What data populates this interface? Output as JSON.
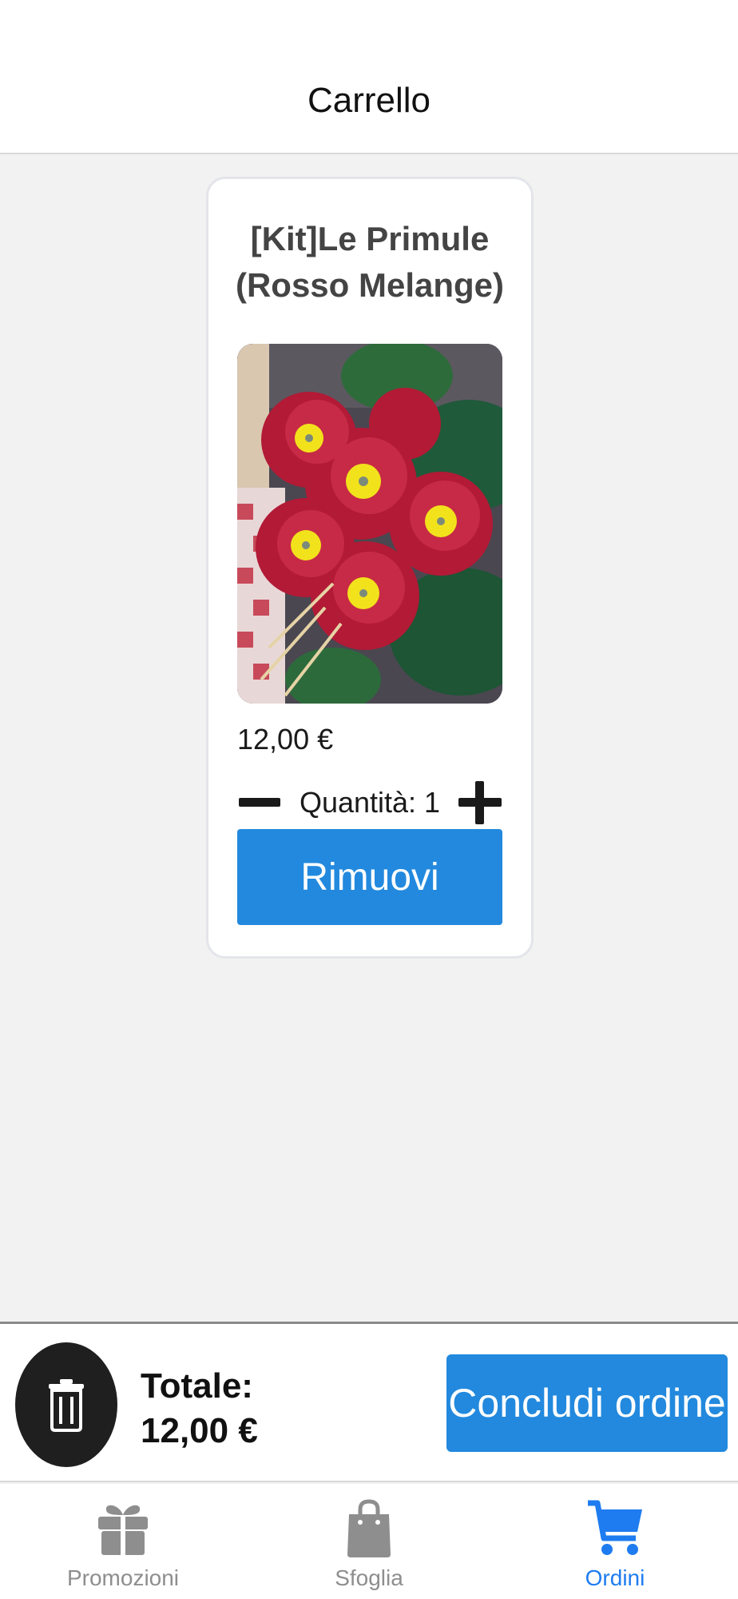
{
  "header": {
    "title": "Carrello"
  },
  "cart_item": {
    "title_line1": "[Kit]Le Primule",
    "title_line2": "(Rosso Melange)",
    "price": "12,00 €",
    "quantity_label": "Quantità: 1",
    "remove_label": "Rimuovi",
    "image_icon": "red-felt-primrose-photo"
  },
  "checkout": {
    "total_label": "Totale:",
    "total_value": "12,00 €",
    "conclude_label": "Concludi ordine",
    "accent_color": "#2289de"
  },
  "tabbar": {
    "tabs": [
      {
        "label": "Promozioni",
        "icon": "gift-icon",
        "active": false
      },
      {
        "label": "Sfoglia",
        "icon": "shopping-bag-icon",
        "active": false
      },
      {
        "label": "Ordini",
        "icon": "cart-icon",
        "active": true
      }
    ],
    "active_color": "#1e7cf0",
    "inactive_color": "#8e8e8e"
  }
}
